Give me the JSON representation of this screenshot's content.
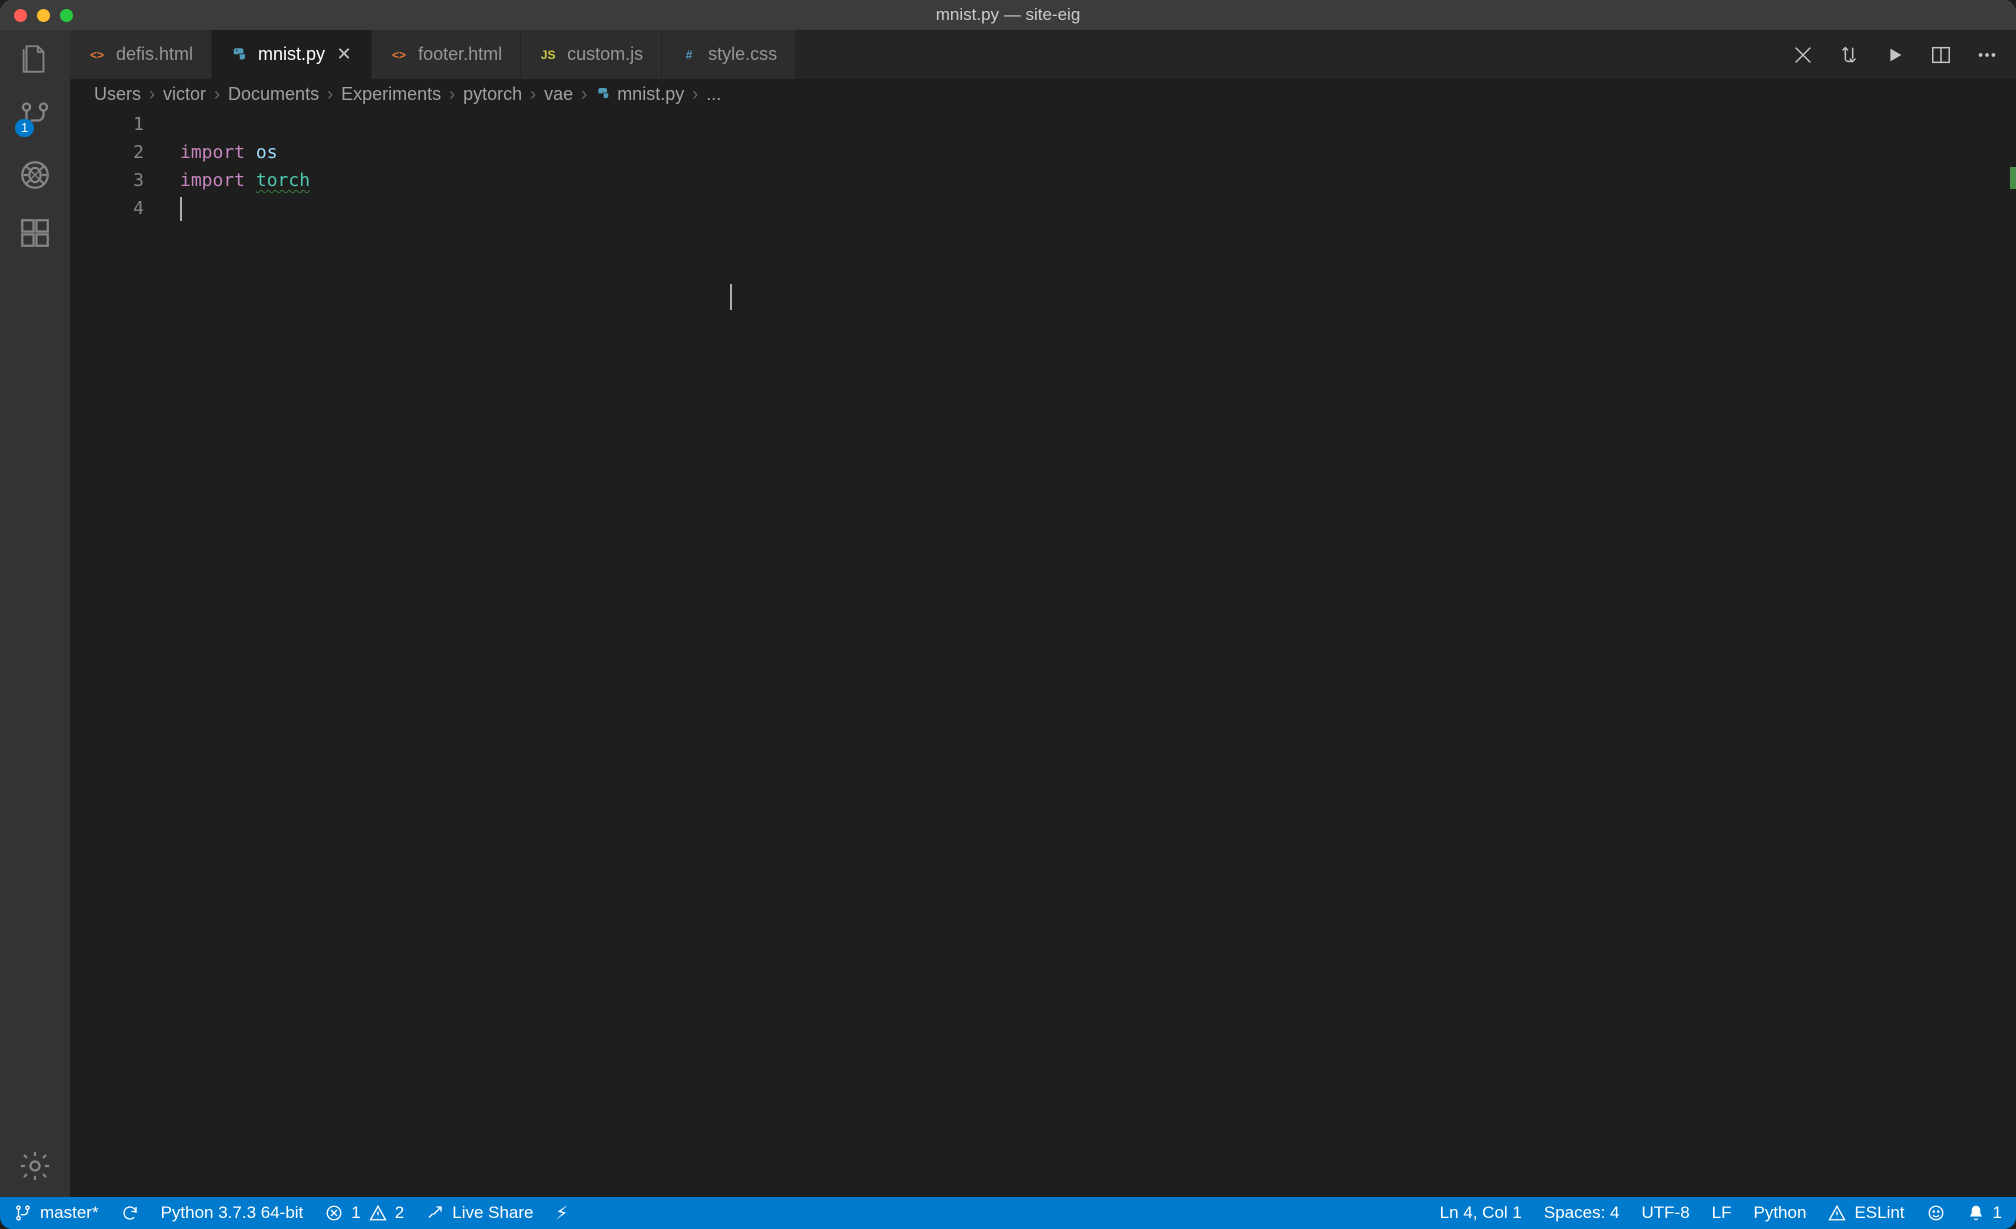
{
  "window": {
    "title": "mnist.py — site-eig"
  },
  "activity": {
    "scm_badge": "1"
  },
  "tabs": [
    {
      "label": "defis.html",
      "icon": "html",
      "active": false,
      "closeable": false
    },
    {
      "label": "mnist.py",
      "icon": "python",
      "active": true,
      "closeable": true
    },
    {
      "label": "footer.html",
      "icon": "html",
      "active": false,
      "closeable": false
    },
    {
      "label": "custom.js",
      "icon": "js",
      "active": false,
      "closeable": false
    },
    {
      "label": "style.css",
      "icon": "css",
      "active": false,
      "closeable": false
    }
  ],
  "breadcrumbs": {
    "items": [
      "Users",
      "victor",
      "Documents",
      "Experiments",
      "pytorch",
      "vae"
    ],
    "file": "mnist.py",
    "suffix": "..."
  },
  "editor": {
    "lines": [
      {
        "n": "1",
        "tokens": []
      },
      {
        "n": "2",
        "tokens": [
          {
            "t": "import ",
            "c": "kw"
          },
          {
            "t": "os",
            "c": "id"
          }
        ]
      },
      {
        "n": "3",
        "tokens": [
          {
            "t": "import ",
            "c": "kw"
          },
          {
            "t": "torch",
            "c": "id2"
          }
        ]
      },
      {
        "n": "4",
        "tokens": [],
        "cursor": true
      }
    ]
  },
  "status": {
    "branch": "master*",
    "python": "Python 3.7.3 64-bit",
    "errors": "1",
    "warnings": "2",
    "liveshare": "Live Share",
    "cursor": "Ln 4, Col 1",
    "spaces": "Spaces: 4",
    "encoding": "UTF-8",
    "eol": "LF",
    "lang": "Python",
    "eslint": "ESLint",
    "bell": "1"
  }
}
